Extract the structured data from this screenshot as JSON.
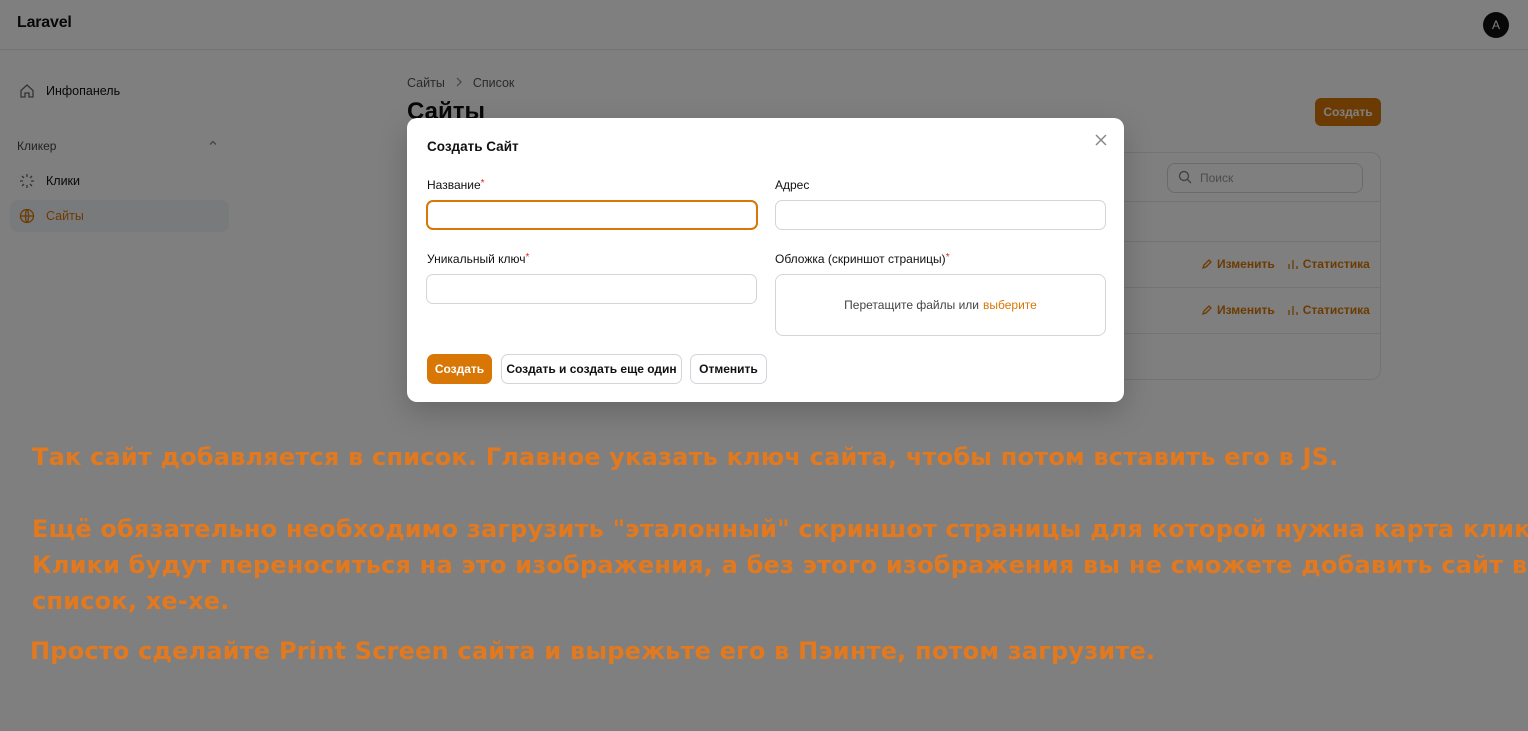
{
  "app": {
    "brand": "Laravel",
    "avatar_initial": "A"
  },
  "sidebar": {
    "dashboard": "Инфопанель",
    "group_label": "Кликер",
    "items": [
      {
        "label": "Клики",
        "icon": "sparkle-icon"
      },
      {
        "label": "Сайты",
        "icon": "globe-icon"
      }
    ]
  },
  "main": {
    "breadcrumbs": [
      "Сайты",
      "Список"
    ],
    "page_title": "Сайты",
    "create_label": "Создать",
    "search_placeholder": "Поиск",
    "row_actions": {
      "edit": "Изменить",
      "stats": "Статистика"
    }
  },
  "modal": {
    "title": "Создать Сайт",
    "fields": {
      "name": {
        "label": "Название",
        "value": ""
      },
      "address": {
        "label": "Адрес",
        "value": ""
      },
      "key": {
        "label": "Уникальный ключ",
        "value": ""
      },
      "cover": {
        "label": "Обложка (скриншот страницы)",
        "drop_text": "Перетащите файлы или",
        "drop_link": "выберите"
      }
    },
    "buttons": {
      "create": "Создать",
      "create_another": "Создать и создать еще один",
      "cancel": "Отменить"
    }
  },
  "notes": {
    "line1": "Так сайт добавляется в список. Главное указать ключ сайта, чтобы потом вставить его в JS.",
    "line2": "Ещё обязательно необходимо загрузить \"эталонный\" скриншот страницы для которой нужна карта кликов.",
    "line3": "Клики будут переноситься на это изображения, а без этого изображения вы не сможете добавить сайт в",
    "line4": "список, хе-хе.",
    "line5": "Просто сделайте Print Screen сайта и вырежьте его в Пэинте, потом загрузите."
  },
  "colors": {
    "accent": "#d97706",
    "note": "#e2791f",
    "overlay": "rgba(0,0,0,0.5)"
  }
}
